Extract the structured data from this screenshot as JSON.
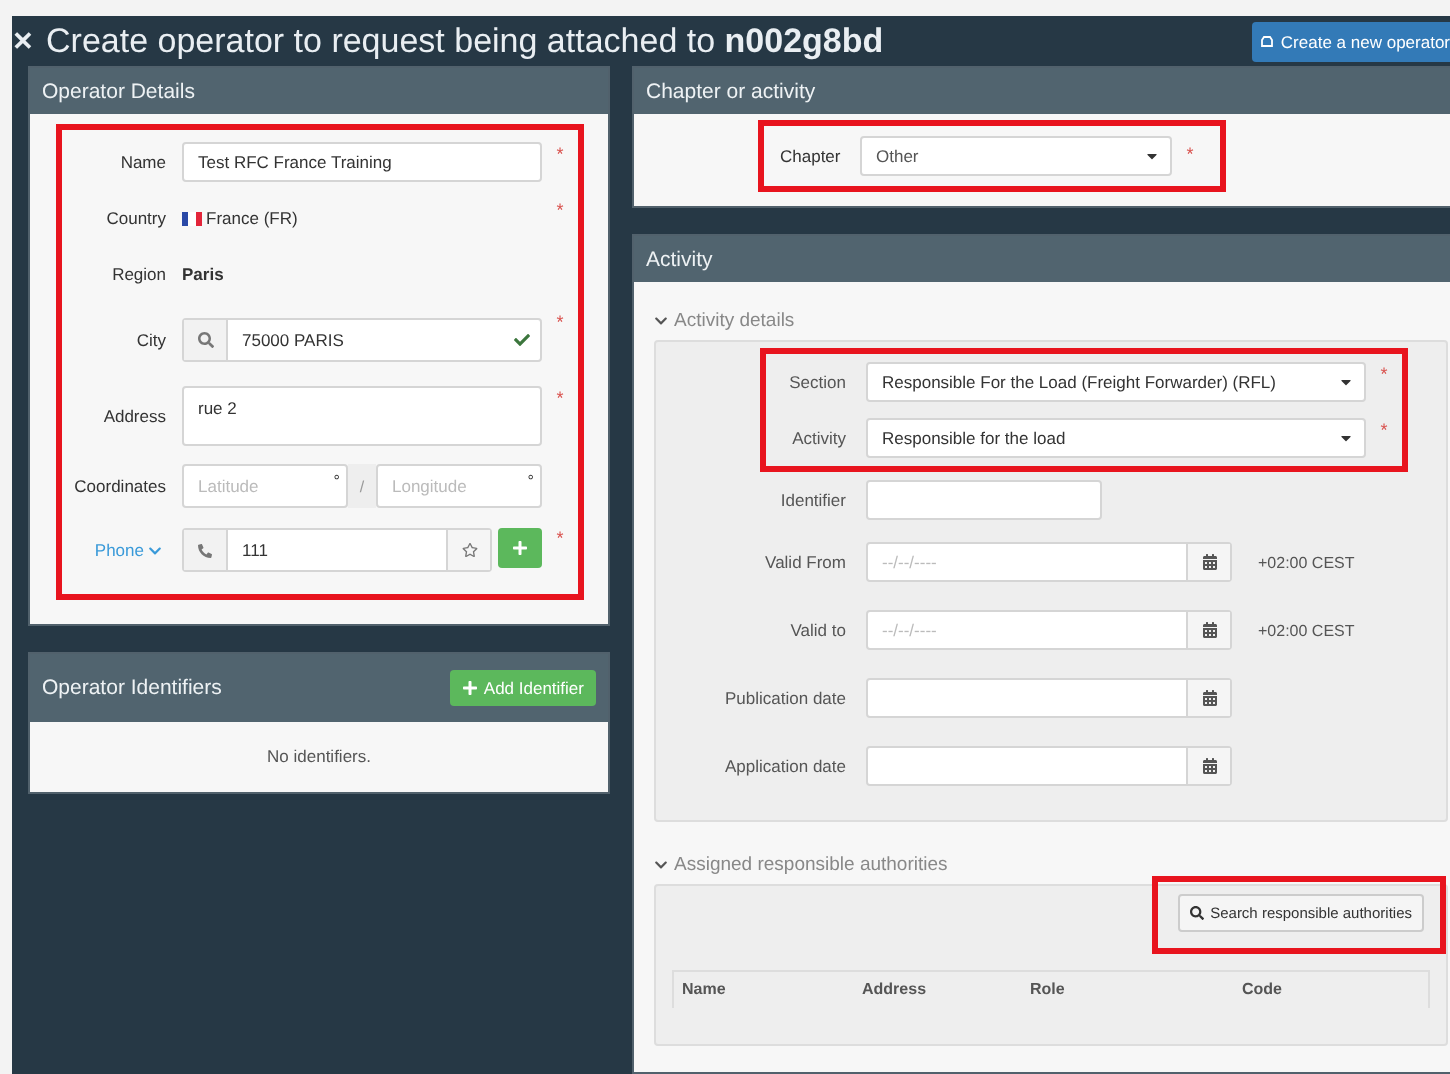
{
  "header": {
    "title_prefix": "Create operator to request being attached to ",
    "title_code": "n002g8bd",
    "close_icon": "✕",
    "action_button": "Create a new operator"
  },
  "operator_details": {
    "title": "Operator Details",
    "highlighted": true,
    "fields": [
      {
        "kind": "text",
        "label": "Name",
        "value": "Test RFC France Training",
        "required_mark": "*"
      },
      {
        "kind": "country",
        "label": "Country",
        "value": "France (FR)",
        "required_mark": "*"
      },
      {
        "kind": "plain",
        "label": "Region",
        "value": "Paris"
      },
      {
        "kind": "search",
        "label": "City",
        "value": "75000 PARIS",
        "valid": true,
        "required_mark": "*"
      },
      {
        "kind": "textarea",
        "label": "Address",
        "value": "rue 2",
        "required_mark": "*"
      },
      {
        "kind": "coordinates",
        "label": "Coordinates",
        "placeholder": "Latitude",
        "placeholder_2": "Longitude",
        "separator": "/",
        "unit": "°"
      },
      {
        "kind": "phone",
        "label": "Phone",
        "value": "111",
        "required_mark": "*"
      }
    ]
  },
  "operator_identifiers": {
    "title": "Operator Identifiers",
    "add_button": "Add Identifier",
    "empty_text": "No identifiers."
  },
  "chapter_panel": {
    "title": "Chapter or activity",
    "highlighted": true,
    "label": "Chapter",
    "value": "Other",
    "required_mark": "*"
  },
  "activity_panel": {
    "title": "Activity",
    "details_title": "Activity details",
    "details_expanded": true,
    "highlighted": true,
    "highlighted_fields": [
      {
        "kind": "select",
        "label": "Section",
        "value": "Responsible For the Load (Freight Forwarder) (RFL)",
        "required_mark": "*"
      },
      {
        "kind": "select",
        "label": "Activity",
        "value": "Responsible for the load",
        "required_mark": "*"
      }
    ],
    "fields": [
      {
        "kind": "text",
        "label": "Identifier"
      },
      {
        "kind": "date",
        "label": "Valid From",
        "placeholder": "--/--/----",
        "suffix": "+02:00 CEST"
      },
      {
        "kind": "date",
        "label": "Valid to",
        "placeholder": "--/--/----",
        "suffix": "+02:00 CEST"
      },
      {
        "kind": "date",
        "label": "Publication date"
      },
      {
        "kind": "date",
        "label": "Application date"
      }
    ],
    "authorities_title": "Assigned responsible authorities",
    "authorities_expanded": true,
    "search_button": "Search responsible authorities",
    "search_highlighted": true,
    "columns": [
      "Name",
      "Address",
      "Role",
      "Code"
    ]
  }
}
